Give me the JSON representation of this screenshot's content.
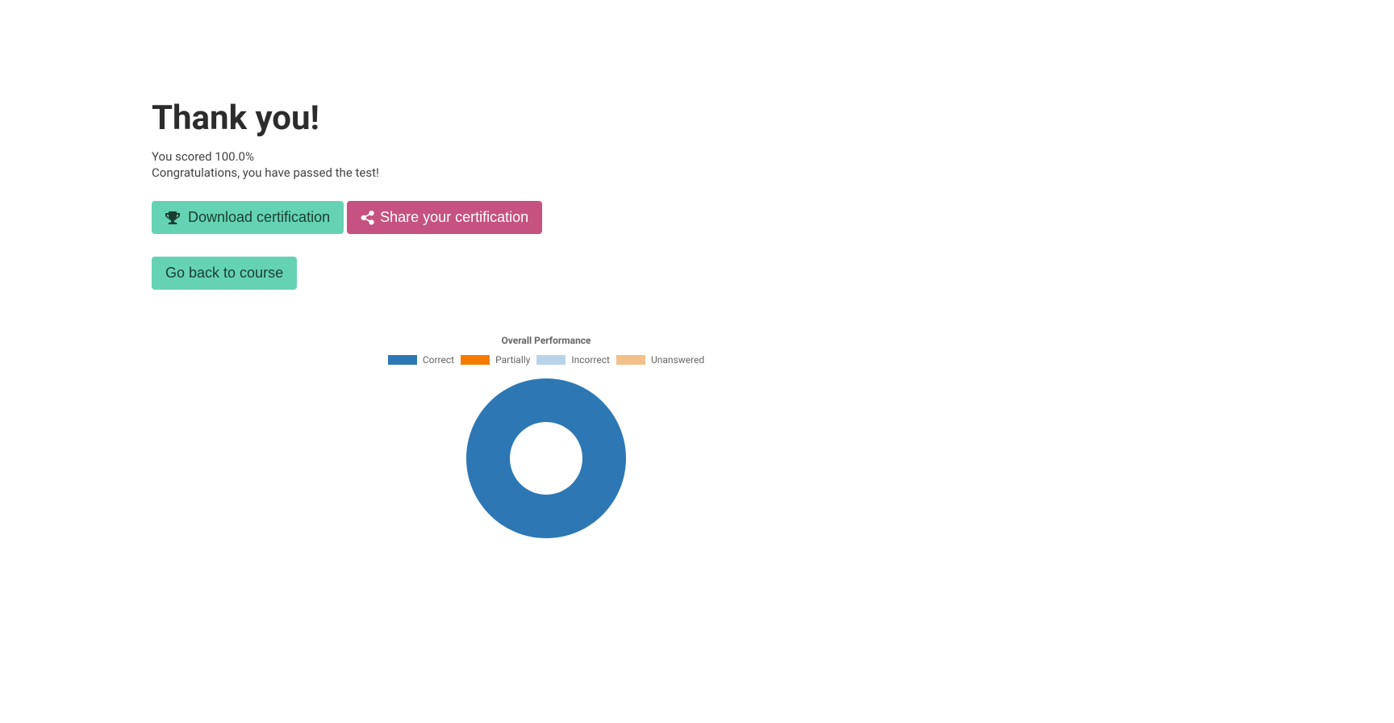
{
  "header": {
    "title": "Thank you!",
    "score_line": "You scored 100.0%",
    "congrats_line": "Congratulations, you have passed the test!"
  },
  "buttons": {
    "download": "Download certification",
    "share": "Share your certification",
    "back": "Go back to course"
  },
  "chart_data": {
    "type": "pie",
    "title": "Overall Performance",
    "series": [
      {
        "name": "Correct",
        "value": 100,
        "color": "#2d78b4"
      },
      {
        "name": "Partially",
        "value": 0,
        "color": "#f57c00"
      },
      {
        "name": "Incorrect",
        "value": 0,
        "color": "#b9d3ea"
      },
      {
        "name": "Unanswered",
        "value": 0,
        "color": "#f3c089"
      }
    ]
  }
}
